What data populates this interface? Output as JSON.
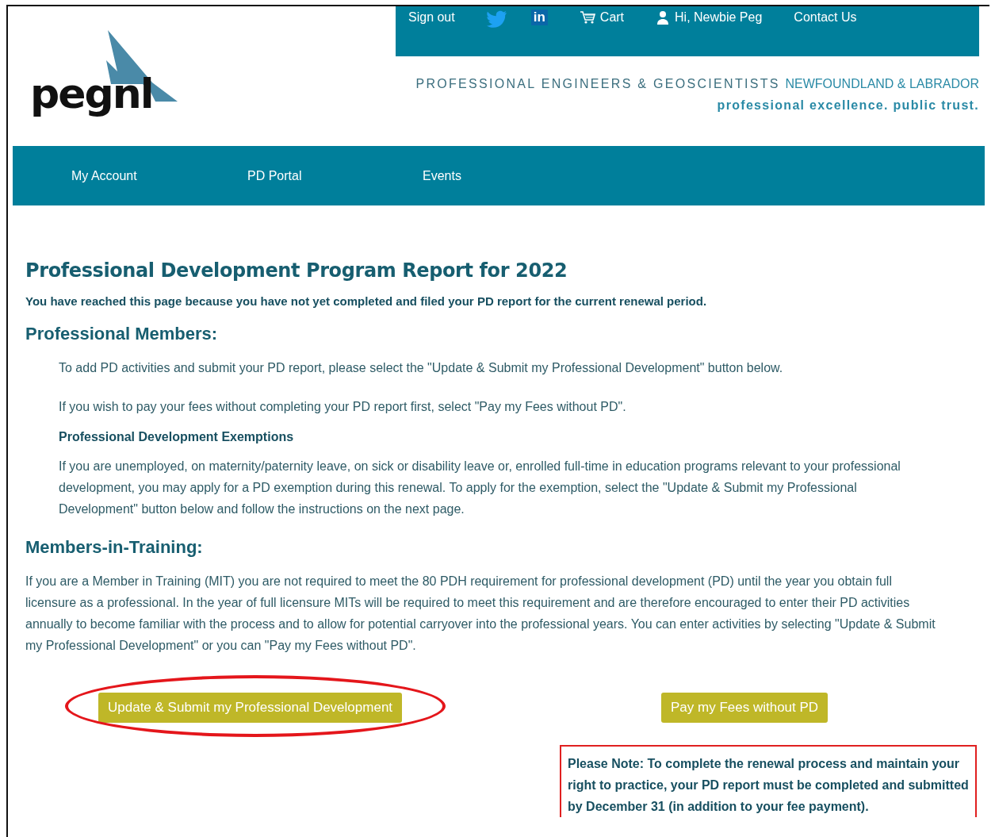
{
  "logo": {
    "text": "pegnl"
  },
  "top_bar": {
    "items": [
      {
        "kind": "link",
        "label": "Sign out"
      },
      {
        "kind": "twitter"
      },
      {
        "kind": "linkedin",
        "label": "in"
      },
      {
        "kind": "cart",
        "label": "Cart"
      },
      {
        "kind": "user",
        "label": "Hi, Newbie Peg"
      },
      {
        "kind": "link",
        "label": "Contact Us"
      }
    ]
  },
  "org_name": {
    "main": "PROFESSIONAL ENGINEERS & GEOSCIENTISTS",
    "region": "NEWFOUNDLAND & LABRADOR"
  },
  "tagline": "professional excellence. public trust.",
  "nav": [
    {
      "label": "My Account"
    },
    {
      "label": "PD Portal"
    },
    {
      "label": "Events"
    }
  ],
  "title": "Professional Development Program Report for 2022",
  "intro": "You have reached this page because you have not yet completed and filed your PD report for the current renewal period.",
  "sections": [
    {
      "heading": "Professional Members:",
      "indented": true,
      "blocks": [
        {
          "kind": "paragraph",
          "text": "To add PD activities and submit your PD report, please select the \"Update & Submit my Professional Development\" button below."
        },
        {
          "kind": "paragraph",
          "text": "If you wish to pay your fees without completing your PD report first, select \"Pay my Fees without PD\"."
        },
        {
          "kind": "subheading",
          "text": "Professional Development Exemptions"
        },
        {
          "kind": "paragraph",
          "text": "If you are unemployed, on maternity/paternity leave, on sick or disability leave or, enrolled full-time in education programs relevant to your professional development, you may apply for a PD exemption during this renewal. To apply for the exemption, select the \"Update & Submit my Professional Development\" button below and follow the instructions on the next page."
        }
      ]
    },
    {
      "heading": "Members-in-Training:",
      "indented": false,
      "blocks": [
        {
          "kind": "paragraph",
          "text": "If you are a Member in Training (MIT) you are not required to meet the 80 PDH requirement for professional development (PD) until the year you obtain full licensure as a professional. In the year of full licensure MITs will be required to meet this requirement and are therefore encouraged to enter their PD activities annually to become familiar with the process and to allow for potential carryover into the professional years. You can enter activities by selecting \"Update & Submit my Professional Development\" or you can \"Pay my Fees without PD\"."
        }
      ]
    }
  ],
  "buttons": [
    {
      "label": "Update & Submit my Professional Development",
      "circled": true
    },
    {
      "label": "Pay my Fees without PD",
      "circled": false
    }
  ],
  "note": "Please Note: To complete the renewal process and maintain your right to practice, your PD report must be completed and submitted by December 31 (in addition to your fee payment)."
}
